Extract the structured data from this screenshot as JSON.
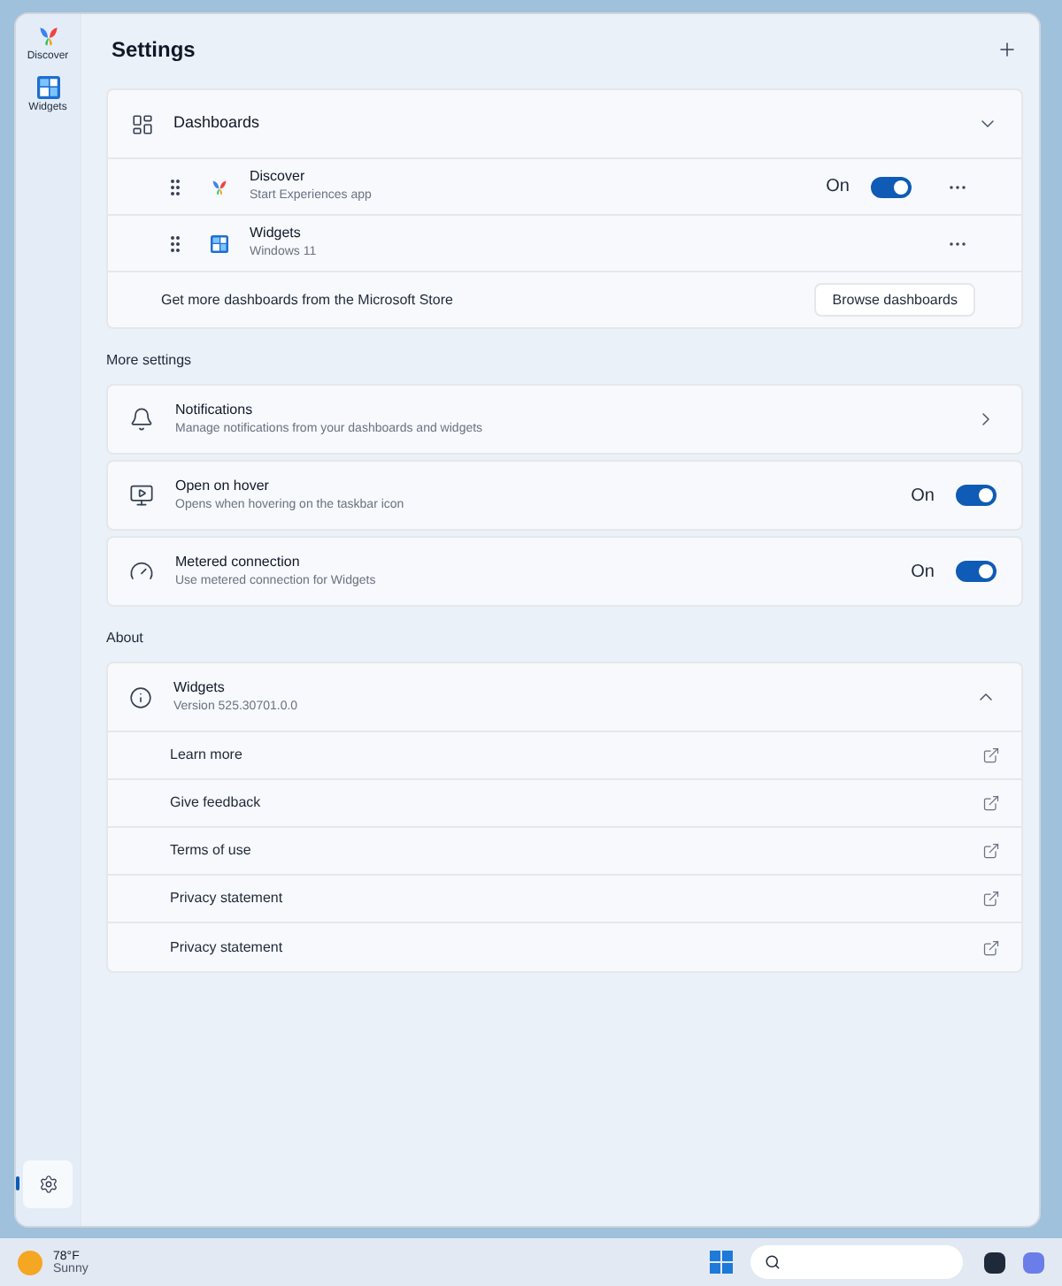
{
  "sidebar": {
    "items": [
      {
        "label": "Discover",
        "kind": "discover",
        "selected": false
      },
      {
        "label": "Widgets",
        "kind": "widgets",
        "selected": false
      }
    ],
    "settings_button": {
      "selected": true
    }
  },
  "title": "Settings",
  "dashboards": {
    "title": "Dashboards",
    "expanded": true,
    "items": [
      {
        "name": "Discover",
        "description": "Start Experiences app",
        "kind": "discover",
        "toggle": {
          "on": true,
          "label": "On"
        }
      },
      {
        "name": "Widgets",
        "description": "Windows 11",
        "kind": "widgets"
      }
    ],
    "store_text": "Get more dashboards from the Microsoft Store",
    "store_button": "Browse dashboards"
  },
  "more_settings": {
    "heading": "More settings",
    "items": [
      {
        "kind": "notifications",
        "title": "Notifications",
        "description": "Manage notifications from your dashboards and widgets"
      },
      {
        "kind": "hover",
        "title": "Open on hover",
        "description": "Opens when hovering on the taskbar icon",
        "toggle": {
          "on": true,
          "label": "On"
        }
      },
      {
        "kind": "metered",
        "title": "Metered connection",
        "description": "Use metered connection for Widgets",
        "toggle": {
          "on": true,
          "label": "On"
        }
      }
    ]
  },
  "about": {
    "heading": "About",
    "title": "Widgets",
    "version": "Version 525.30701.0.0",
    "expanded": true,
    "links": [
      "Learn more",
      "Give feedback",
      "Terms of use",
      "Privacy statement",
      "Privacy statement"
    ]
  },
  "taskbar": {
    "temperature": "78°F",
    "condition": "Sunny"
  }
}
